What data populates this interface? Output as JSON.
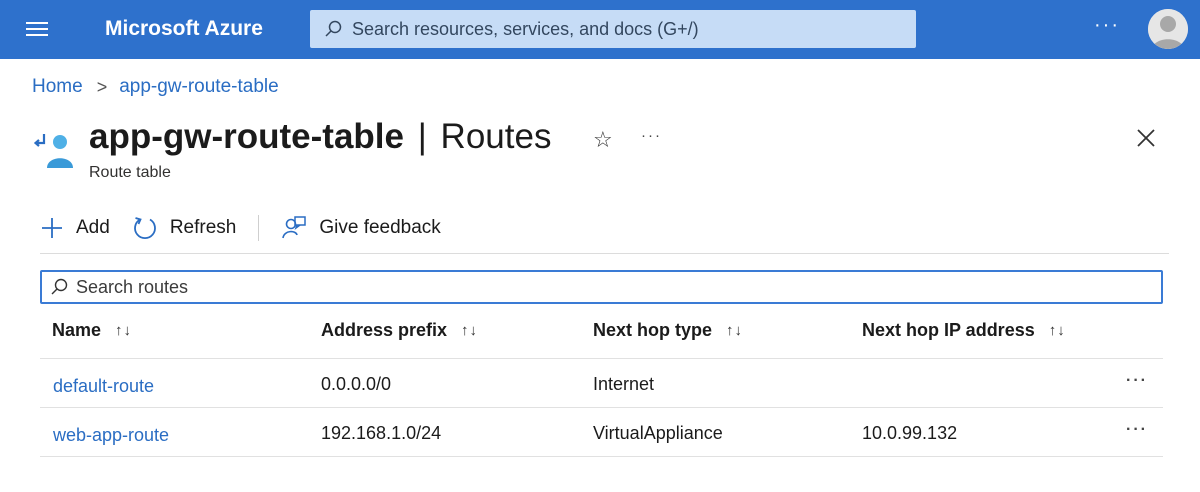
{
  "topbar": {
    "brand": "Microsoft Azure",
    "search_placeholder": "Search resources, services, and docs (G+/)",
    "more": "···",
    "color": "#2e71cc"
  },
  "breadcrumb": {
    "home": "Home",
    "separator": ">",
    "current": "app-gw-route-table"
  },
  "header": {
    "resource_name": "app-gw-route-table",
    "divider": "|",
    "section": "Routes",
    "subtitle": "Route table",
    "star": "☆",
    "more": "···"
  },
  "toolbar": {
    "add_label": "Add",
    "refresh_label": "Refresh",
    "feedback_label": "Give feedback"
  },
  "search": {
    "placeholder": "Search routes"
  },
  "table": {
    "sort_glyph": "↑↓",
    "columns": [
      "Name",
      "Address prefix",
      "Next hop type",
      "Next hop IP address"
    ],
    "rows": [
      {
        "name": "default-route",
        "address_prefix": "0.0.0.0/0",
        "next_hop_type": "Internet",
        "next_hop_ip": ""
      },
      {
        "name": "web-app-route",
        "address_prefix": "192.168.1.0/24",
        "next_hop_type": "VirtualAppliance",
        "next_hop_ip": "10.0.99.132"
      }
    ],
    "row_more": "···"
  },
  "colors": {
    "link": "#2a6dc3",
    "accent": "#3a7bd5"
  }
}
